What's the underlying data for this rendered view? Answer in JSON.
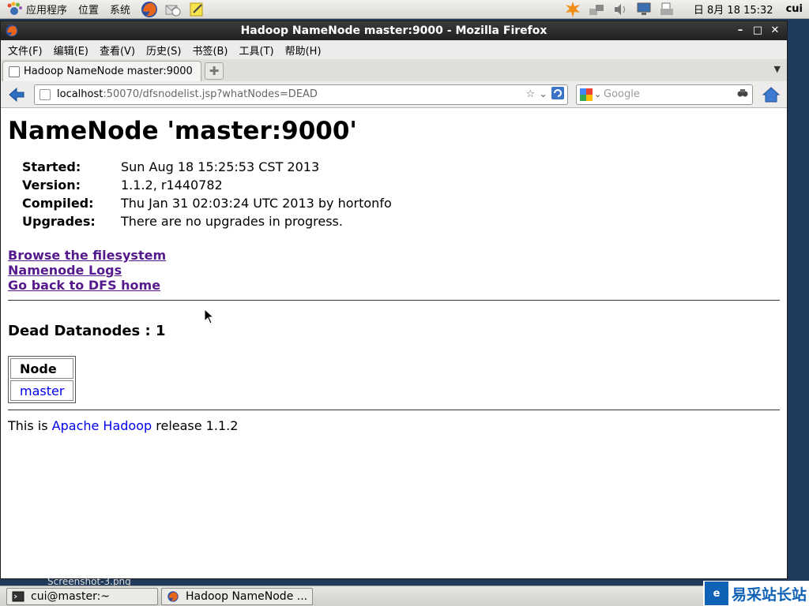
{
  "top_panel": {
    "menus": [
      "应用程序",
      "位置",
      "系统"
    ],
    "clock": "日 8月 18 15:32",
    "user": "cui"
  },
  "window": {
    "title": "Hadoop NameNode master:9000 - Mozilla Firefox",
    "menu": [
      "文件(F)",
      "编辑(E)",
      "查看(V)",
      "历史(S)",
      "书签(B)",
      "工具(T)",
      "帮助(H)"
    ],
    "tab_title": "Hadoop NameNode master:9000",
    "url_host": "localhost",
    "url_rest": ":50070/dfsnodelist.jsp?whatNodes=DEAD",
    "search_placeholder": "Google"
  },
  "page": {
    "title": "NameNode 'master:9000'",
    "info": [
      {
        "key": "Started:",
        "value": "Sun Aug 18 15:25:53 CST 2013"
      },
      {
        "key": "Version:",
        "value": "1.1.2, r1440782"
      },
      {
        "key": "Compiled:",
        "value": "Thu Jan 31 02:03:24 UTC 2013 by hortonfo"
      },
      {
        "key": "Upgrades:",
        "value": "There are no upgrades in progress."
      }
    ],
    "links": [
      "Browse the filesystem",
      "Namenode Logs",
      "Go back to DFS home"
    ],
    "dead_heading": "Dead Datanodes : 1",
    "nodes_header": "Node",
    "nodes": [
      "master"
    ],
    "footer_prefix": "This is ",
    "footer_link": "Apache Hadoop",
    "footer_suffix": " release 1.1.2"
  },
  "desktop_label": "Screenshot-3.png",
  "taskbar": [
    "cui@master:~",
    "Hadoop NameNode ..."
  ],
  "watermark": "易采站长站",
  "colors": {
    "visited_link": "#551a8b",
    "link": "#0000ee",
    "titlebar": "#2b2b2b"
  }
}
